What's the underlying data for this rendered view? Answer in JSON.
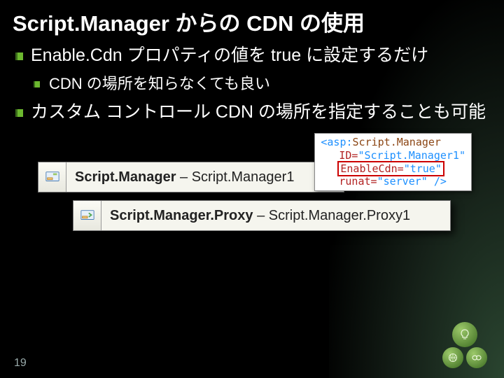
{
  "title": "Script.Manager からの CDN の使用",
  "bullets": {
    "b1": "Enable.Cdn プロパティの値を true に設定するだけ",
    "b1a": "CDN の場所を知らなくても良い",
    "b2": "カスタム コントロール CDN の場所を指定することも可能"
  },
  "code": {
    "open": "<asp:",
    "tag": "Script.Manager",
    "attr_id": "ID=",
    "val_id": "\"Script.Manager1\"",
    "attr_cdn": "EnableCdn=",
    "val_cdn": "\"true\"",
    "attr_runat": "runat=",
    "val_runat": "\"server\"",
    "close": " />"
  },
  "smarttag1": {
    "bold": "Script.Manager",
    "rest": " – Script.Manager1"
  },
  "smarttag2": {
    "bold": "Script.Manager.Proxy",
    "rest": " – Script.Manager.Proxy1"
  },
  "slide_number": "19"
}
